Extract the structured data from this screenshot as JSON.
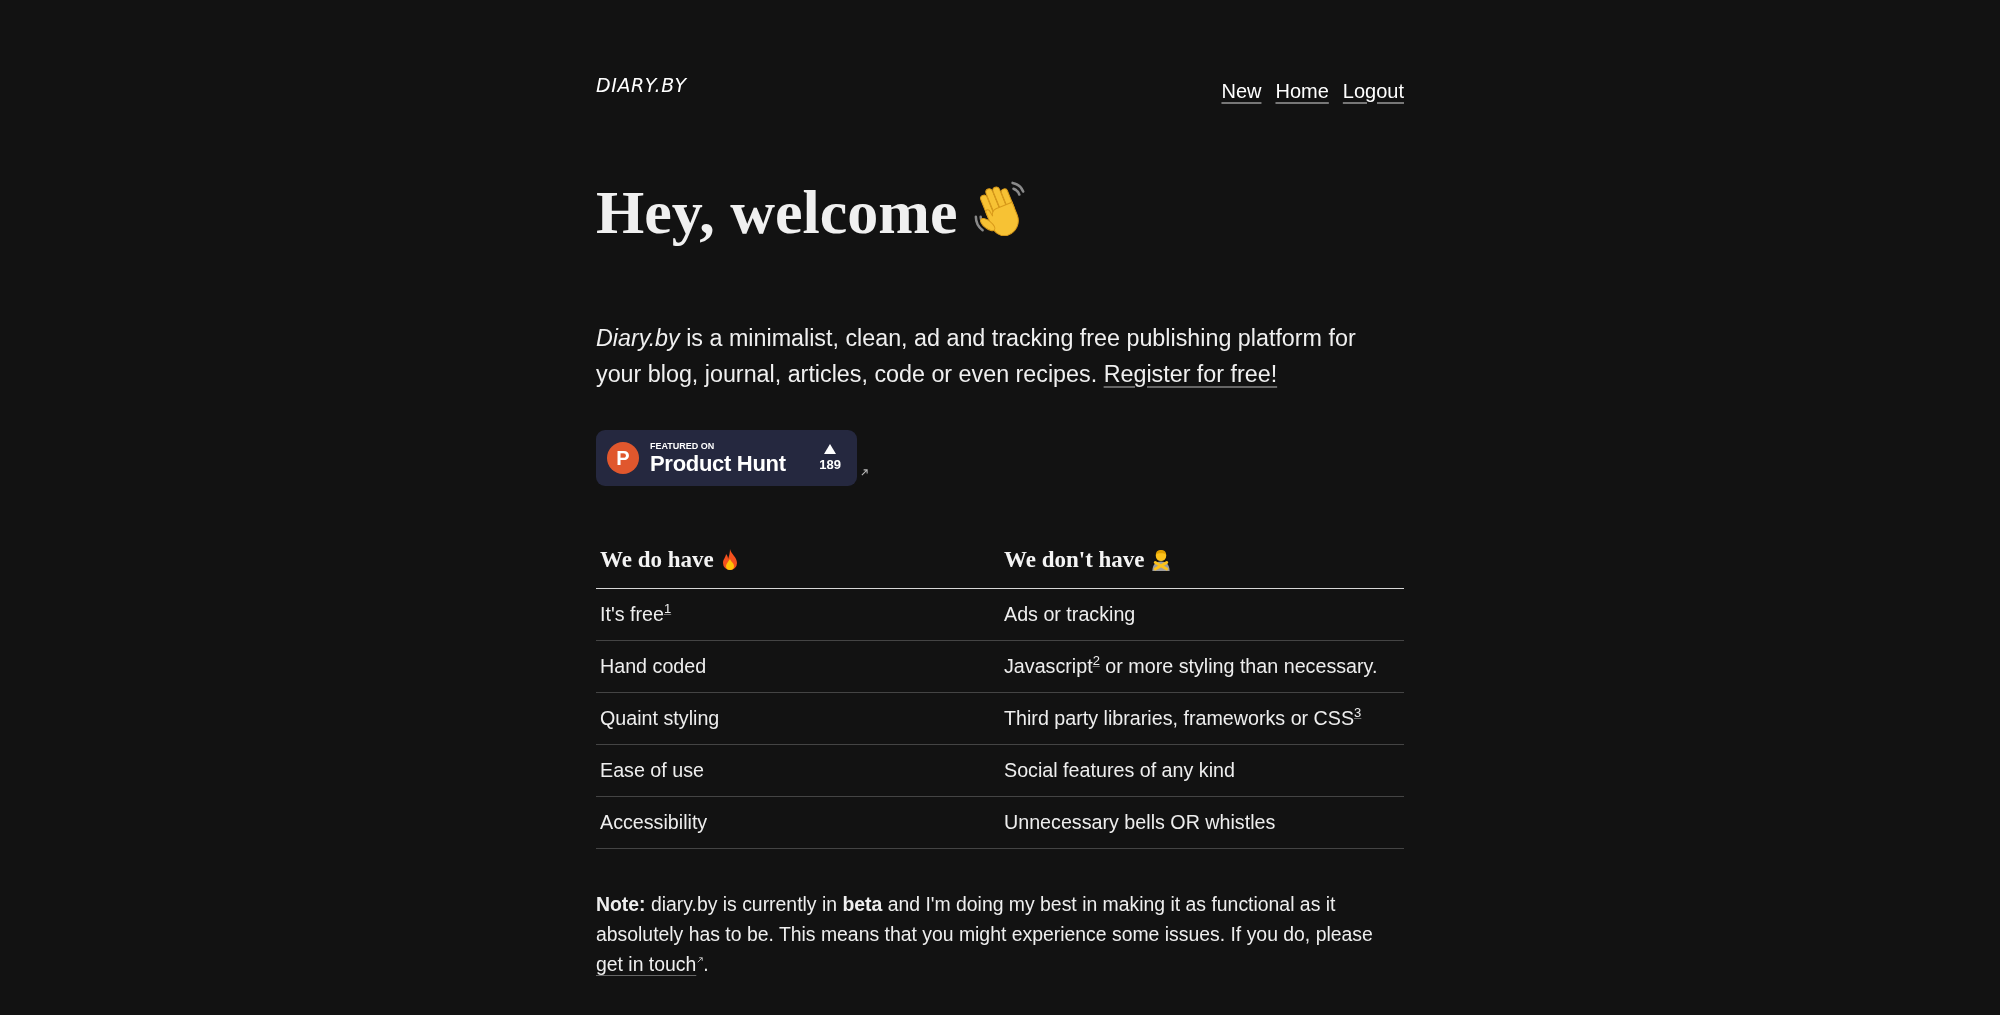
{
  "header": {
    "logo": "DIARY.BY",
    "nav": [
      {
        "label": "New"
      },
      {
        "label": "Home"
      },
      {
        "label": "Logout"
      }
    ]
  },
  "hero": {
    "title": "Hey, welcome",
    "intro": "*Diary.by* is a minimalist, clean, ad and tracking free publishing platform for your blog, journal, articles, code or even recipes.",
    "register_link": "Register for free!"
  },
  "badge": {
    "letter": "P",
    "caption": "FEATURED ON",
    "name": "Product Hunt",
    "votes": "189"
  },
  "table": {
    "columns": [
      {
        "title": "We do have"
      },
      {
        "title": "We don't have"
      }
    ],
    "rows": [
      [
        "It's free$^{1}$",
        "Ads or tracking"
      ],
      [
        "Hand coded",
        "Javascript$^{2}$ or more styling than necessary."
      ],
      [
        "Quaint styling",
        "Third party libraries, frameworks or CSS$^{3}$"
      ],
      [
        "Ease of use",
        "Social features of any kind"
      ],
      [
        "Accessibility",
        "Unnecessary bells OR whistles"
      ]
    ]
  },
  "note": {
    "text": "**Note:** diary.by is currently in **beta** and I'm doing my best in making it as functional as it absolutely has to be. This means that you might experience some issues. If you do, please",
    "link": "get in touch",
    "after": "."
  }
}
